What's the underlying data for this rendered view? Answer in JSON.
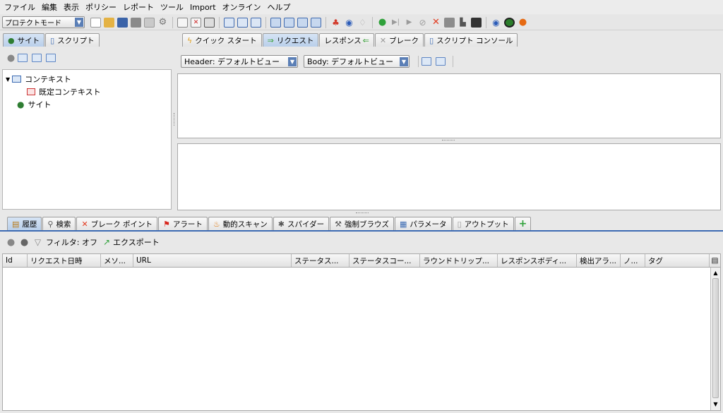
{
  "menu": [
    "ファイル",
    "編集",
    "表示",
    "ポリシー",
    "レポート",
    "ツール",
    "Import",
    "オンライン",
    "ヘルプ"
  ],
  "toolbar": {
    "mode": "プロテクトモード"
  },
  "left_tabs": [
    {
      "label": "サイト",
      "icon": "globe-icon",
      "active": true
    },
    {
      "label": "スクリプト",
      "icon": "script-icon",
      "active": false
    }
  ],
  "tree": [
    {
      "label": "コンテキスト",
      "level": 0,
      "expanded": true,
      "icon": "context-folder-icon"
    },
    {
      "label": "既定コンテキスト",
      "level": 1,
      "icon": "context-icon"
    },
    {
      "label": "サイト",
      "level": 0,
      "icon": "globe-icon"
    }
  ],
  "right_tabs": [
    {
      "label": "クイック スタート",
      "icon": "lightning-icon",
      "active": false
    },
    {
      "label": "リクエスト",
      "icon": "arrow-right-icon",
      "active": true
    },
    {
      "label": "レスポンス",
      "icon": "arrow-left-icon",
      "active": false
    },
    {
      "label": "ブレーク",
      "icon": "cross-icon",
      "active": false
    },
    {
      "label": "スクリプト コンソール",
      "icon": "script-icon",
      "active": false
    }
  ],
  "request_view": {
    "header_label": "Header: デフォルトビュー",
    "body_label": "Body: デフォルトビュー"
  },
  "bottom_tabs": [
    {
      "label": "履歴",
      "icon": "history-icon",
      "active": true
    },
    {
      "label": "検索",
      "icon": "search-icon",
      "active": false
    },
    {
      "label": "ブレーク ポイント",
      "icon": "cross-icon",
      "active": false
    },
    {
      "label": "アラート",
      "icon": "flag-icon",
      "active": false
    },
    {
      "label": "動的スキャン",
      "icon": "fire-icon",
      "active": false
    },
    {
      "label": "スパイダー",
      "icon": "spider-icon",
      "active": false
    },
    {
      "label": "強制ブラウズ",
      "icon": "hammer-icon",
      "active": false
    },
    {
      "label": "パラメータ",
      "icon": "table-icon",
      "active": false
    },
    {
      "label": "アウトプット",
      "icon": "document-icon",
      "active": false
    }
  ],
  "history_toolbar": {
    "filter": "フィルタ: オフ",
    "export": "エクスポート"
  },
  "table": {
    "columns": [
      "Id",
      "リクエスト日時",
      "メソ...",
      "URL",
      "ステータス...",
      "ステータスコー...",
      "ラウンドトリップ...",
      "レスポンスボディ...",
      "検出アラ...",
      "ノ...",
      "タグ"
    ]
  }
}
